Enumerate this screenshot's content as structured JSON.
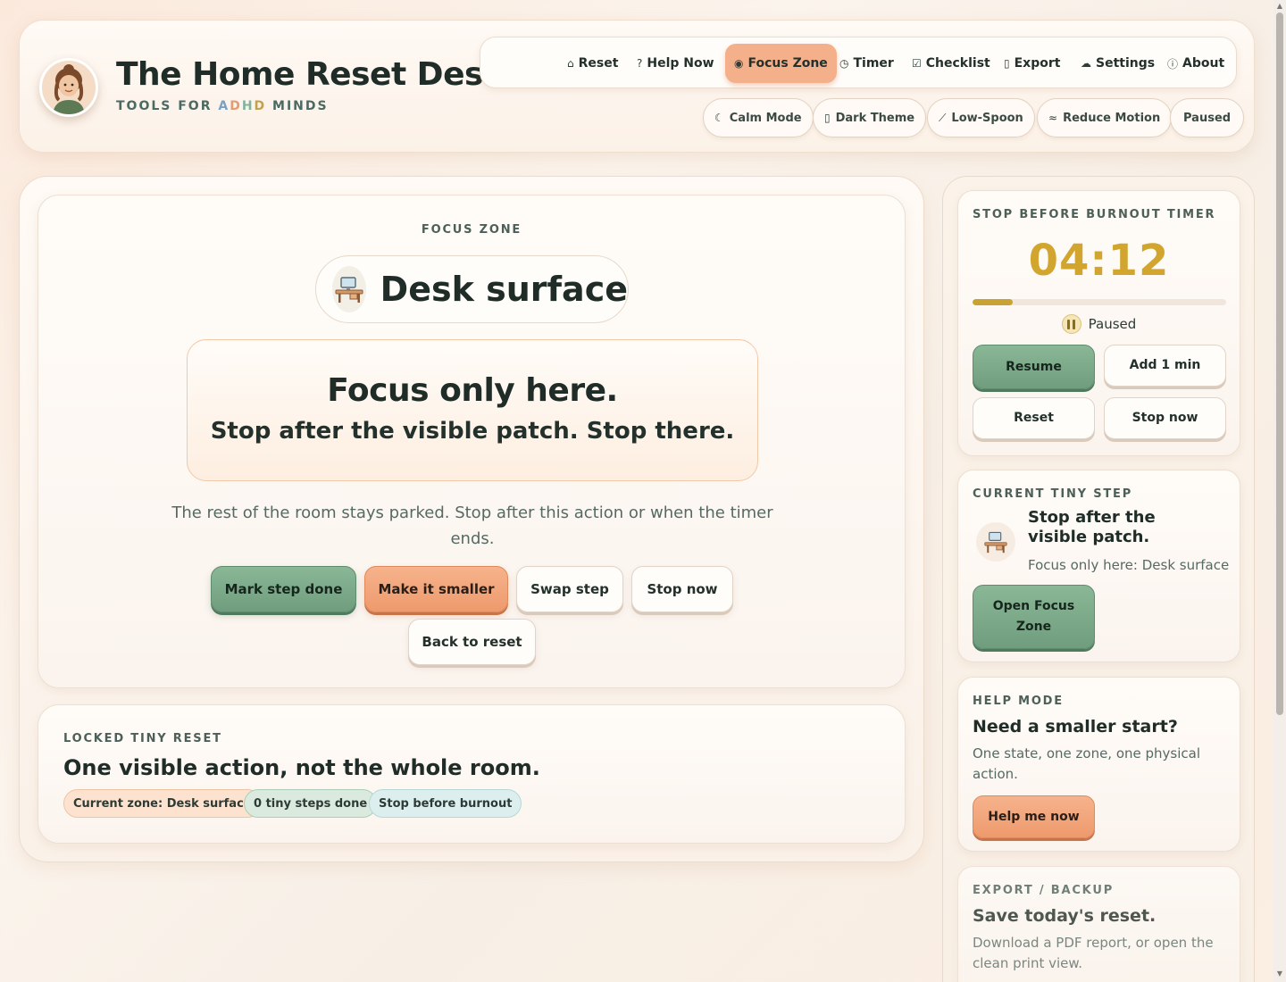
{
  "brand": {
    "title": "The Home Reset Desk",
    "sub_prefix": "TOOLS FOR ",
    "sub_letters": [
      "A",
      "D",
      "H",
      "D"
    ],
    "sub_suffix": " MINDS"
  },
  "nav": [
    {
      "label": "Reset",
      "icon": "home-icon",
      "glyph": "⌂"
    },
    {
      "label": "Help Now",
      "icon": "help-icon",
      "glyph": "?"
    },
    {
      "label": "Focus Zone",
      "icon": "eye-icon",
      "glyph": "◉",
      "active": true
    },
    {
      "label": "Timer",
      "icon": "stopwatch-icon",
      "glyph": "◷"
    },
    {
      "label": "Checklist",
      "icon": "checkbox-icon",
      "glyph": "☑"
    },
    {
      "label": "Export",
      "icon": "document-icon",
      "glyph": "▯"
    },
    {
      "label": "Settings",
      "icon": "cloud-icon",
      "glyph": "☁"
    },
    {
      "label": "About",
      "icon": "info-icon",
      "glyph": "ⓘ"
    }
  ],
  "toggles": [
    {
      "label": "Calm Mode",
      "icon": "moon-icon",
      "glyph": "☾"
    },
    {
      "label": "Dark Theme",
      "icon": "capsule-icon",
      "glyph": "▯"
    },
    {
      "label": "Low-Spoon",
      "icon": "spoon-icon",
      "glyph": "⟋"
    },
    {
      "label": "Reduce Motion",
      "icon": "waves-icon",
      "glyph": "≈"
    },
    {
      "label": "Paused",
      "icon": "",
      "glyph": ""
    }
  ],
  "focus": {
    "eyebrow": "FOCUS ZONE",
    "zone": "Desk surface",
    "headline": "Focus only here.",
    "subline": "Stop after the visible patch. Stop there.",
    "note": "The rest of the room stays parked. Stop after this action or when the timer ends.",
    "buttons": {
      "done": "Mark step done",
      "smaller": "Make it smaller",
      "swap": "Swap step",
      "stop": "Stop now",
      "back": "Back to reset"
    }
  },
  "locked": {
    "eyebrow": "LOCKED TINY RESET",
    "title": "One visible action, not the whole room.",
    "tags": [
      "Current zone: Desk surface",
      "0 tiny steps done",
      "Stop before burnout"
    ]
  },
  "timer": {
    "eyebrow": "STOP BEFORE BURNOUT TIMER",
    "value": "04:12",
    "progress": 0.16,
    "status": "Paused",
    "buttons": {
      "resume": "Resume",
      "add": "Add 1 min",
      "reset": "Reset",
      "stop": "Stop now"
    },
    "accent": "#d1a52e"
  },
  "tiny_step": {
    "eyebrow": "CURRENT TINY STEP",
    "title": "Stop after the visible patch.",
    "detail": "Focus only here: Desk surface",
    "button": "Open Focus Zone"
  },
  "help": {
    "eyebrow": "HELP MODE",
    "title": "Need a smaller start?",
    "text": "One state, one zone, one physical action.",
    "button": "Help me now"
  },
  "export": {
    "eyebrow": "EXPORT / BACKUP",
    "title": "Save today's reset.",
    "text": "Download a PDF report, or open the clean print view."
  },
  "colors": {
    "green": "#7aa886",
    "orange": "#f2a57a",
    "peach": "#fde3cf",
    "gold": "#d1a52e"
  }
}
